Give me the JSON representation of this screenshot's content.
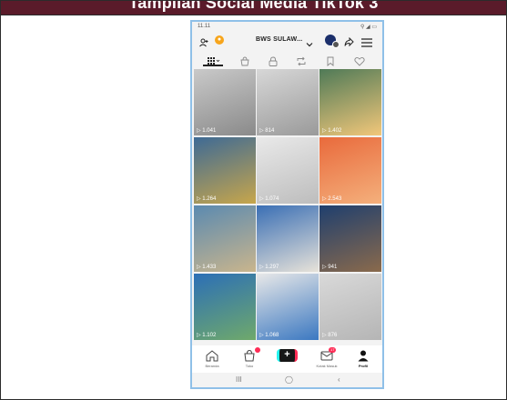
{
  "document": {
    "heading": "Tampilan Social Media TikTok 3"
  },
  "phone": {
    "status": {
      "time": "11.11",
      "right": "⚲ ◢ ▭"
    },
    "top_bar": {
      "account_name": "BWS SULAW..."
    },
    "tabs": [
      {
        "icon": "grid-icon",
        "selected": true
      },
      {
        "icon": "shopping-bag-icon",
        "selected": false
      },
      {
        "icon": "lock-icon",
        "selected": false
      },
      {
        "icon": "repost-icon",
        "selected": false
      },
      {
        "icon": "bookmark-icon",
        "selected": false
      },
      {
        "icon": "heart-icon",
        "selected": false
      }
    ],
    "videos": [
      {
        "views": "▷ 1.041",
        "colors": [
          "#c9c9c9",
          "#8a8a8a"
        ]
      },
      {
        "views": "▷ 814",
        "colors": [
          "#d7d7d7",
          "#9a9a9a"
        ]
      },
      {
        "views": "▷ 1.402",
        "colors": [
          "#4f7a57",
          "#f2c77a"
        ]
      },
      {
        "views": "▷ 1.264",
        "colors": [
          "#3e6a95",
          "#c7a64b"
        ]
      },
      {
        "views": "▷ 1.074",
        "colors": [
          "#e9e9e9",
          "#bdbdbd"
        ]
      },
      {
        "views": "▷ 2.543",
        "colors": [
          "#e96a3c",
          "#f4b07c"
        ]
      },
      {
        "views": "▷ 1.433",
        "colors": [
          "#5b8ab0",
          "#c9b58d"
        ]
      },
      {
        "views": "▷ 1.297",
        "colors": [
          "#3a6fb5",
          "#e7e2d9"
        ]
      },
      {
        "views": "▷ 941",
        "colors": [
          "#1f3f6e",
          "#8a6a4c"
        ]
      },
      {
        "views": "▷ 1.102",
        "colors": [
          "#2c6fb6",
          "#6fa96b"
        ]
      },
      {
        "views": "▷ 1.068",
        "colors": [
          "#e8e8e8",
          "#3b78c1"
        ]
      },
      {
        "views": "▷ 876",
        "colors": [
          "#d9d9d9",
          "#b5b5b5"
        ]
      }
    ],
    "bottom_nav": {
      "home_label": "Beranda",
      "shop_label": "Toko",
      "inbox_label": "Kotak Masuk",
      "inbox_badge": "17",
      "profile_label": "Profil",
      "shop_badge": ""
    },
    "system_nav": {
      "recent": "III",
      "home": "◯",
      "back": "‹"
    }
  },
  "colors": {
    "header_bg": "#5a1b2a",
    "phone_border": "#8fc0e8",
    "accent_cyan": "#25f4ee",
    "accent_red": "#fe2c55"
  }
}
